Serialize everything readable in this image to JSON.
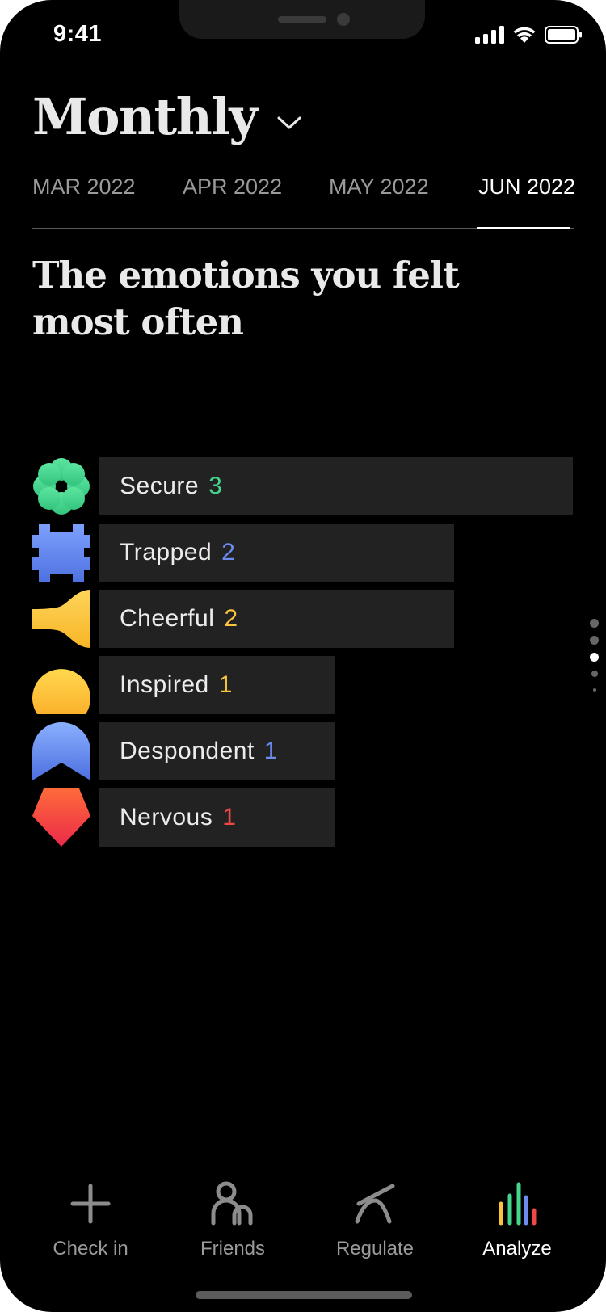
{
  "status_bar": {
    "time": "9:41"
  },
  "header": {
    "title": "Monthly"
  },
  "month_tabs": [
    {
      "label": "MAR 2022",
      "active": false
    },
    {
      "label": "APR 2022",
      "active": false
    },
    {
      "label": "MAY 2022",
      "active": false
    },
    {
      "label": "JUN 2022",
      "active": true
    }
  ],
  "section": {
    "heading": "The emotions you felt most often"
  },
  "emotions": [
    {
      "label": "Secure",
      "count": "3",
      "count_color": "#45d58c",
      "icon": "flower-shape-icon"
    },
    {
      "label": "Trapped",
      "count": "2",
      "count_color": "#6c8cf0",
      "icon": "puzzle-shape-icon"
    },
    {
      "label": "Cheerful",
      "count": "2",
      "count_color": "#fcc43c",
      "icon": "trumpet-shape-icon"
    },
    {
      "label": "Inspired",
      "count": "1",
      "count_color": "#fcc43c",
      "icon": "sun-shape-icon"
    },
    {
      "label": "Despondent",
      "count": "1",
      "count_color": "#6c8cf0",
      "icon": "arch-shape-icon"
    },
    {
      "label": "Nervous",
      "count": "1",
      "count_color": "#f04848",
      "icon": "pentagon-shape-icon"
    }
  ],
  "page_indicator": {
    "total": 5,
    "current": 3
  },
  "tab_bar": [
    {
      "label": "Check in",
      "icon": "plus-icon",
      "active": false
    },
    {
      "label": "Friends",
      "icon": "friends-icon",
      "active": false
    },
    {
      "label": "Regulate",
      "icon": "regulate-icon",
      "active": false
    },
    {
      "label": "Analyze",
      "icon": "analyze-bars-icon",
      "active": true
    }
  ]
}
